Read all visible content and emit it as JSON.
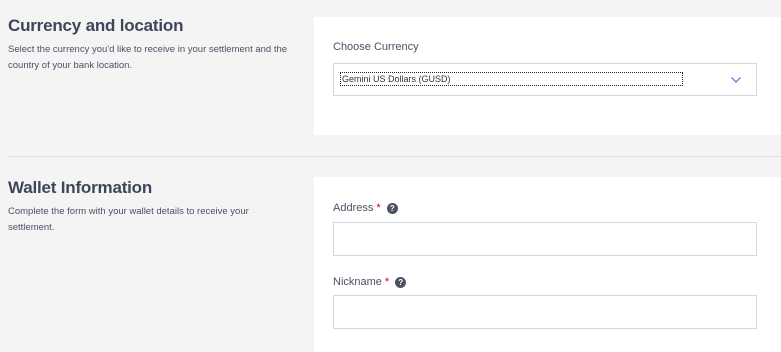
{
  "currency_section": {
    "title": "Currency and location",
    "description": "Select the currency you'd like to receive in your settlement and the country of your bank location.",
    "choose_currency_label": "Choose Currency",
    "selected_currency": "Gemini US Dollars (GUSD)"
  },
  "wallet_section": {
    "title": "Wallet Information",
    "description": "Complete the form with your wallet details to receive your settlement.",
    "address_label": "Address",
    "address_value": "",
    "nickname_label": "Nickname",
    "nickname_value": "",
    "required_marker": "*",
    "help_glyph": "?"
  },
  "icons": {
    "select_chevron": "chevron-down-icon",
    "help": "question-circle-icon"
  },
  "colors": {
    "accent": "#4a90e2",
    "required": "#d0021b"
  }
}
